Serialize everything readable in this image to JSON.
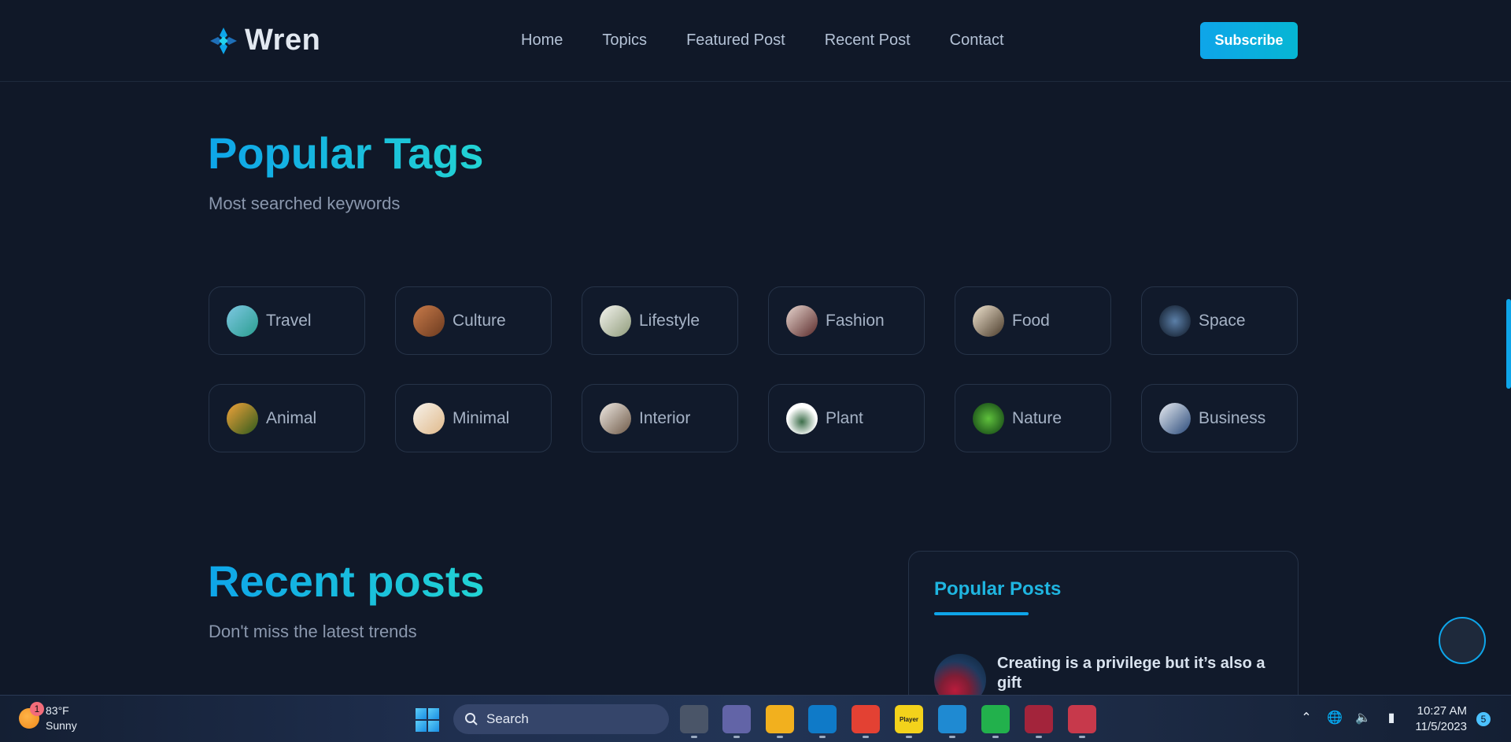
{
  "header": {
    "logo_text": "Wren",
    "nav": [
      "Home",
      "Topics",
      "Featured Post",
      "Recent Post",
      "Contact"
    ],
    "subscribe_label": "Subscribe"
  },
  "popular_tags": {
    "title": "Popular Tags",
    "subtitle": "Most searched keywords",
    "tags": [
      {
        "label": "Travel",
        "thumb": "linear-gradient(135deg,#7ec8e3,#2a9d8f)"
      },
      {
        "label": "Culture",
        "thumb": "linear-gradient(135deg,#c97b4a,#6b3a1f)"
      },
      {
        "label": "Lifestyle",
        "thumb": "linear-gradient(135deg,#f5f5f0,#8f9b7a)"
      },
      {
        "label": "Fashion",
        "thumb": "linear-gradient(135deg,#e8d6cf,#5a2a2a)"
      },
      {
        "label": "Food",
        "thumb": "linear-gradient(135deg,#f0e4d0,#4a3b2a)"
      },
      {
        "label": "Space",
        "thumb": "radial-gradient(circle,#5b7fa8,#0d1522)"
      },
      {
        "label": "Animal",
        "thumb": "linear-gradient(135deg,#f2a33a,#2e5a1c)"
      },
      {
        "label": "Minimal",
        "thumb": "linear-gradient(135deg,#f7f3ec,#e0b98a)"
      },
      {
        "label": "Interior",
        "thumb": "linear-gradient(135deg,#efeae4,#6f5a48)"
      },
      {
        "label": "Plant",
        "thumb": "radial-gradient(circle at 50% 60%,#3c6e4a,#ffffff 60%)"
      },
      {
        "label": "Nature",
        "thumb": "radial-gradient(circle,#5fc13c,#0d3a12)"
      },
      {
        "label": "Business",
        "thumb": "linear-gradient(135deg,#e9edf2,#2a4a7a)"
      }
    ]
  },
  "recent_posts": {
    "title": "Recent posts",
    "subtitle": "Don't miss the latest trends"
  },
  "popular_posts": {
    "title": "Popular Posts",
    "items": [
      {
        "title": "Creating is a privilege but it’s also a gift"
      }
    ]
  },
  "taskbar": {
    "weather": {
      "badge": "1",
      "temp": "83°F",
      "condition": "Sunny"
    },
    "search_placeholder": "Search",
    "apps": [
      {
        "name": "task-view",
        "color": "#4a5568",
        "label": ""
      },
      {
        "name": "chat",
        "color": "#6264a7",
        "label": ""
      },
      {
        "name": "file-explorer",
        "color": "#f2b01e",
        "label": ""
      },
      {
        "name": "edge",
        "color": "#0f7ac8",
        "label": ""
      },
      {
        "name": "chrome",
        "color": "#e34133",
        "label": ""
      },
      {
        "name": "player",
        "color": "#f3d21b",
        "label": "Player"
      },
      {
        "name": "vscode",
        "color": "#1f8ad2",
        "label": ""
      },
      {
        "name": "app-green",
        "color": "#22b14c",
        "label": ""
      },
      {
        "name": "winrar",
        "color": "#a3243b",
        "label": ""
      },
      {
        "name": "snipping-tool",
        "color": "#c7394b",
        "label": ""
      }
    ],
    "clock": {
      "time": "10:27 AM",
      "date": "11/5/2023"
    },
    "notifications": "5"
  }
}
